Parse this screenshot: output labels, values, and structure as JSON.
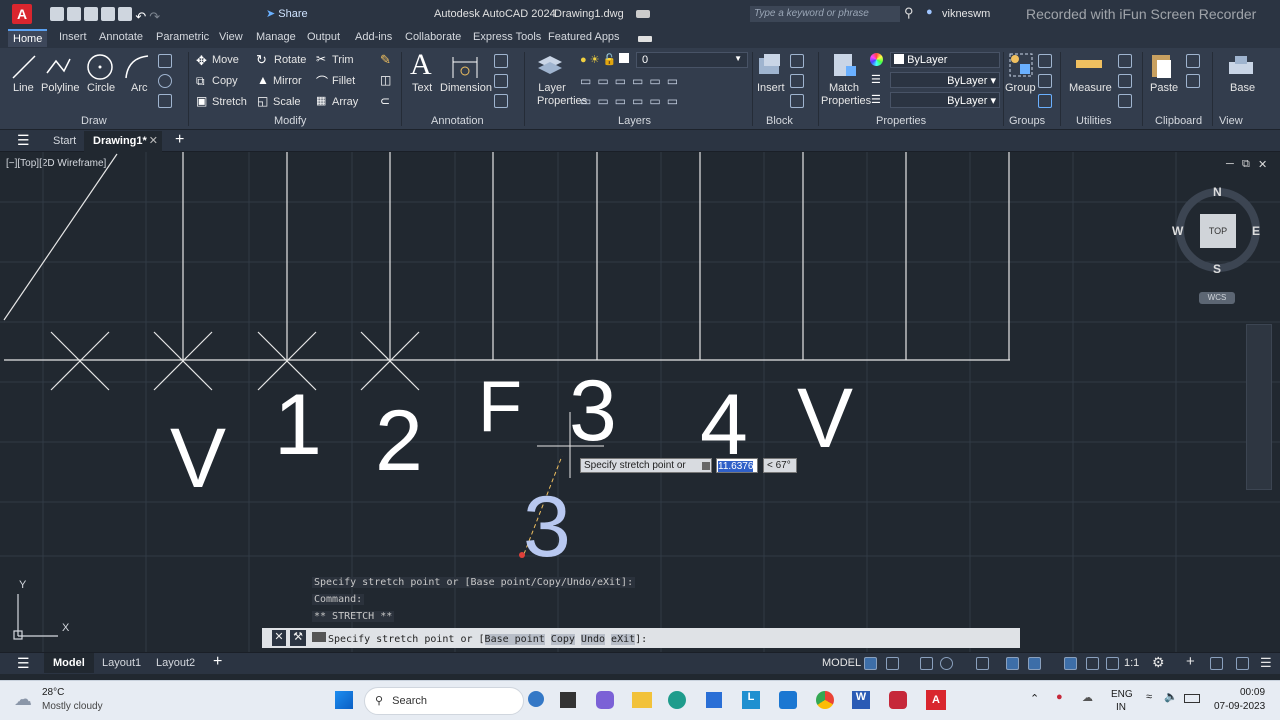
{
  "title_bar": {
    "app_logo": "A",
    "share": "Share",
    "app_title": "Autodesk AutoCAD 2024",
    "file_name": "Drawing1.dwg",
    "search_placeholder": "Type a keyword or phrase",
    "user": "vikneswm",
    "watermark": "Recorded with iFun Screen Recorder"
  },
  "ribbon_tabs": [
    "Home",
    "Insert",
    "Annotate",
    "Parametric",
    "View",
    "Manage",
    "Output",
    "Add-ins",
    "Collaborate",
    "Express Tools",
    "Featured Apps"
  ],
  "draw": {
    "line": "Line",
    "polyline": "Polyline",
    "circle": "Circle",
    "arc": "Arc",
    "panel": "Draw"
  },
  "modify": {
    "move": "Move",
    "rotate": "Rotate",
    "trim": "Trim",
    "copy": "Copy",
    "mirror": "Mirror",
    "fillet": "Fillet",
    "stretch": "Stretch",
    "scale": "Scale",
    "array": "Array",
    "panel": "Modify"
  },
  "annotation": {
    "text": "Text",
    "dimension": "Dimension",
    "panel": "Annotation"
  },
  "layers": {
    "layer_properties": "Layer Properties",
    "current_layer": "0",
    "panel": "Layers"
  },
  "block": {
    "insert": "Insert",
    "panel": "Block"
  },
  "properties": {
    "match": "Match Properties",
    "color": "ByLayer",
    "linetype": "ByLayer",
    "lineweight": "ByLayer",
    "panel": "Properties"
  },
  "groups": {
    "group": "Group",
    "panel": "Groups"
  },
  "utilities": {
    "measure": "Measure",
    "panel": "Utilities"
  },
  "clipboard": {
    "paste": "Paste",
    "panel": "Clipboard"
  },
  "view_panel": {
    "base": "Base",
    "panel": "View"
  },
  "doc_tabs": {
    "start": "Start",
    "drawing": "Drawing1*"
  },
  "viewport": {
    "label": "[−][Top][2D Wireframe]",
    "labels": [
      "V",
      "1",
      "2",
      "F",
      "3",
      "4",
      "V",
      "3"
    ],
    "viewcube": {
      "n": "N",
      "s": "S",
      "e": "E",
      "w": "W",
      "top": "TOP",
      "wcs": "WCS"
    },
    "tooltip_prompt": "Specify stretch point or",
    "tooltip_distance": "11.6376",
    "tooltip_angle": "< 67°",
    "ucs_y": "Y",
    "ucs_x": "X"
  },
  "command": {
    "history": [
      "Specify stretch point or [Base point/Copy/Undo/eXit]:",
      "Command:",
      "** STRETCH **"
    ],
    "prompt_prefix": "Specify stretch point or [",
    "opt_base": "Base point",
    "opt_copy": "Copy",
    "opt_undo": "Undo",
    "opt_exit": "eXit",
    "prompt_suffix": "]:"
  },
  "status": {
    "model_tab": "Model",
    "layout1": "Layout1",
    "layout2": "Layout2",
    "model_btn": "MODEL",
    "scale": "1:1"
  },
  "taskbar": {
    "temp": "28°C",
    "weather": "Mostly cloudy",
    "search": "Search",
    "lang1": "ENG",
    "lang2": "IN",
    "time": "00:09",
    "date": "07-09-2023"
  }
}
